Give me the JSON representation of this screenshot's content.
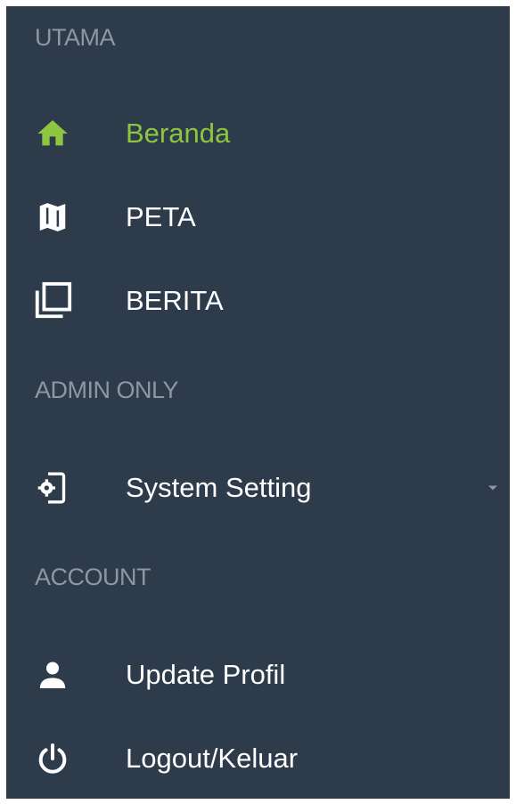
{
  "sidebar": {
    "active_color": "#8dc63f",
    "background_color": "#2d3b4b",
    "sections": [
      {
        "header": "UTAMA",
        "items": [
          {
            "label": "Beranda",
            "icon": "home-icon",
            "active": true
          },
          {
            "label": "PETA",
            "icon": "map-icon",
            "active": false
          },
          {
            "label": "BERITA",
            "icon": "library-icon",
            "active": false
          }
        ]
      },
      {
        "header": "ADMIN ONLY",
        "items": [
          {
            "label": "System Setting",
            "icon": "settings-device-icon",
            "active": false,
            "has_dropdown": true
          }
        ]
      },
      {
        "header": "ACCOUNT",
        "items": [
          {
            "label": "Update Profil",
            "icon": "person-icon",
            "active": false
          },
          {
            "label": "Logout/Keluar",
            "icon": "power-icon",
            "active": false
          }
        ]
      }
    ]
  }
}
